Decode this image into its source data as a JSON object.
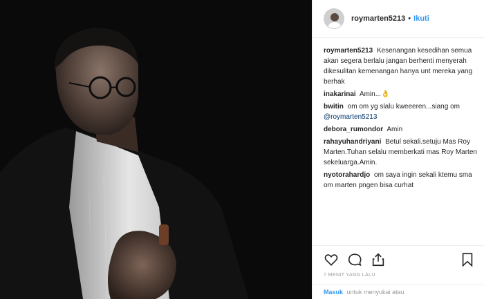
{
  "post": {
    "username": "roymarten5213",
    "dot": "•",
    "follow_label": "Ikuti"
  },
  "comments": [
    {
      "user": "roymarten5213",
      "text": "Kesenangan kesedihan semua akan segera berlalu jangan berhenti menyerah dikesulitan kemenangan hanya unt mereka yang berhak"
    },
    {
      "user": "inakarinai",
      "text": "Amin...👌"
    },
    {
      "user": "bwitin",
      "text": "om om yg slalu kweeeren...siang om",
      "mention": "@roymarten5213"
    },
    {
      "user": "debora_rumondor",
      "text": "Amin"
    },
    {
      "user": "rahayuhandriyani",
      "text": "Betul sekali.setuju Mas Roy Marten.Tuhan selalu memberkati mas Roy Marten sekeluarga.Amin."
    },
    {
      "user": "nyotorahardjo",
      "text": "om saya ingin sekali ktemu sma om marten pngen bisa curhat"
    }
  ],
  "actions": {
    "like_icon": "heart-icon",
    "comment_icon": "comment-icon",
    "share_icon": "share-icon",
    "save_icon": "bookmark-icon"
  },
  "timestamp": "7 MENIT YANG LALU",
  "login": {
    "link": "Masuk",
    "text": "untuk menyukai atau"
  }
}
